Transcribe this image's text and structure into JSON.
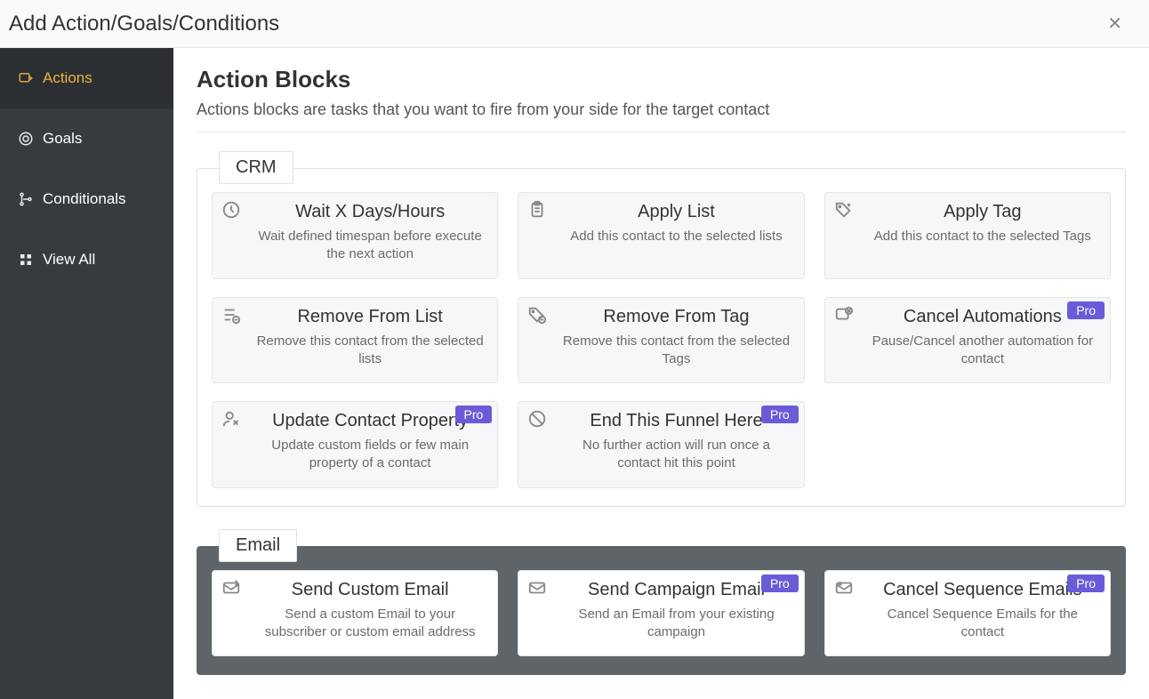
{
  "header": {
    "title": "Add Action/Goals/Conditions"
  },
  "sidebar": {
    "items": [
      {
        "label": "Actions"
      },
      {
        "label": "Goals"
      },
      {
        "label": "Conditionals"
      },
      {
        "label": "View All"
      }
    ]
  },
  "main": {
    "heading": "Action Blocks",
    "subheading": "Actions blocks are tasks that you want to fire from your side for the target contact"
  },
  "badges": {
    "pro": "Pro"
  },
  "groups": {
    "crm": {
      "label": "CRM",
      "cards": [
        {
          "title": "Wait X Days/Hours",
          "desc": "Wait defined timespan before execute the next action"
        },
        {
          "title": "Apply List",
          "desc": "Add this contact to the selected lists"
        },
        {
          "title": "Apply Tag",
          "desc": "Add this contact to the selected Tags"
        },
        {
          "title": "Remove From List",
          "desc": "Remove this contact from the selected lists"
        },
        {
          "title": "Remove From Tag",
          "desc": "Remove this contact from the selected Tags"
        },
        {
          "title": "Cancel Automations",
          "desc": "Pause/Cancel another automation for contact"
        },
        {
          "title": "Update Contact Property",
          "desc": "Update custom fields or few main property of a contact"
        },
        {
          "title": "End This Funnel Here",
          "desc": "No further action will run once a contact hit this point"
        }
      ]
    },
    "email": {
      "label": "Email",
      "cards": [
        {
          "title": "Send Custom Email",
          "desc": "Send a custom Email to your subscriber or custom email address"
        },
        {
          "title": "Send Campaign Email",
          "desc": "Send an Email from your existing campaign"
        },
        {
          "title": "Cancel Sequence Emails",
          "desc": "Cancel Sequence Emails for the contact"
        }
      ]
    }
  }
}
